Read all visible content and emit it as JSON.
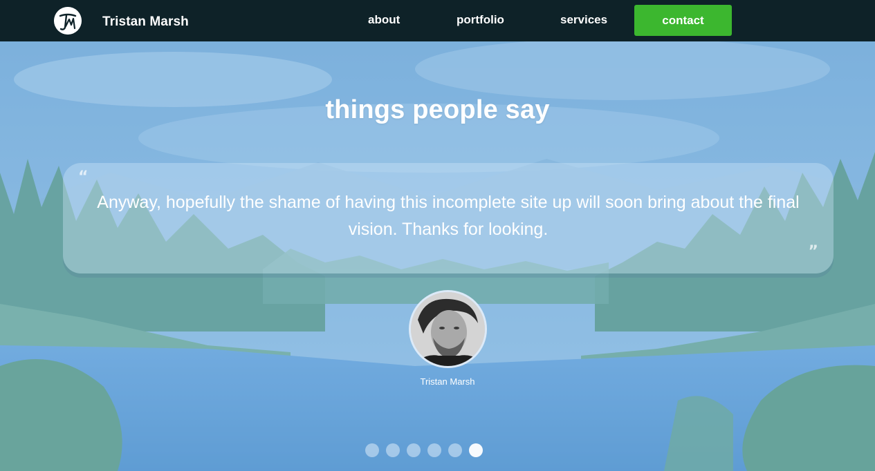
{
  "nav": {
    "brand_name": "Tristan Marsh",
    "logo_icon": "tm-monogram-icon",
    "links": [
      "about",
      "portfolio",
      "services"
    ],
    "contact_label": "contact",
    "colors": {
      "navbar_bg": "#0e2228",
      "contact_bg": "#3cb72f"
    }
  },
  "testimonials": {
    "title": "things people say",
    "quote_open": "“",
    "quote_close": "”",
    "quote": "Anyway, hopefully the shame of having this incomplete site up will soon bring about the final vision. Thanks for looking.",
    "author": "Tristan Marsh",
    "avatar_icon": "profile-photo",
    "dots_total": 6,
    "active_dot": 6
  }
}
